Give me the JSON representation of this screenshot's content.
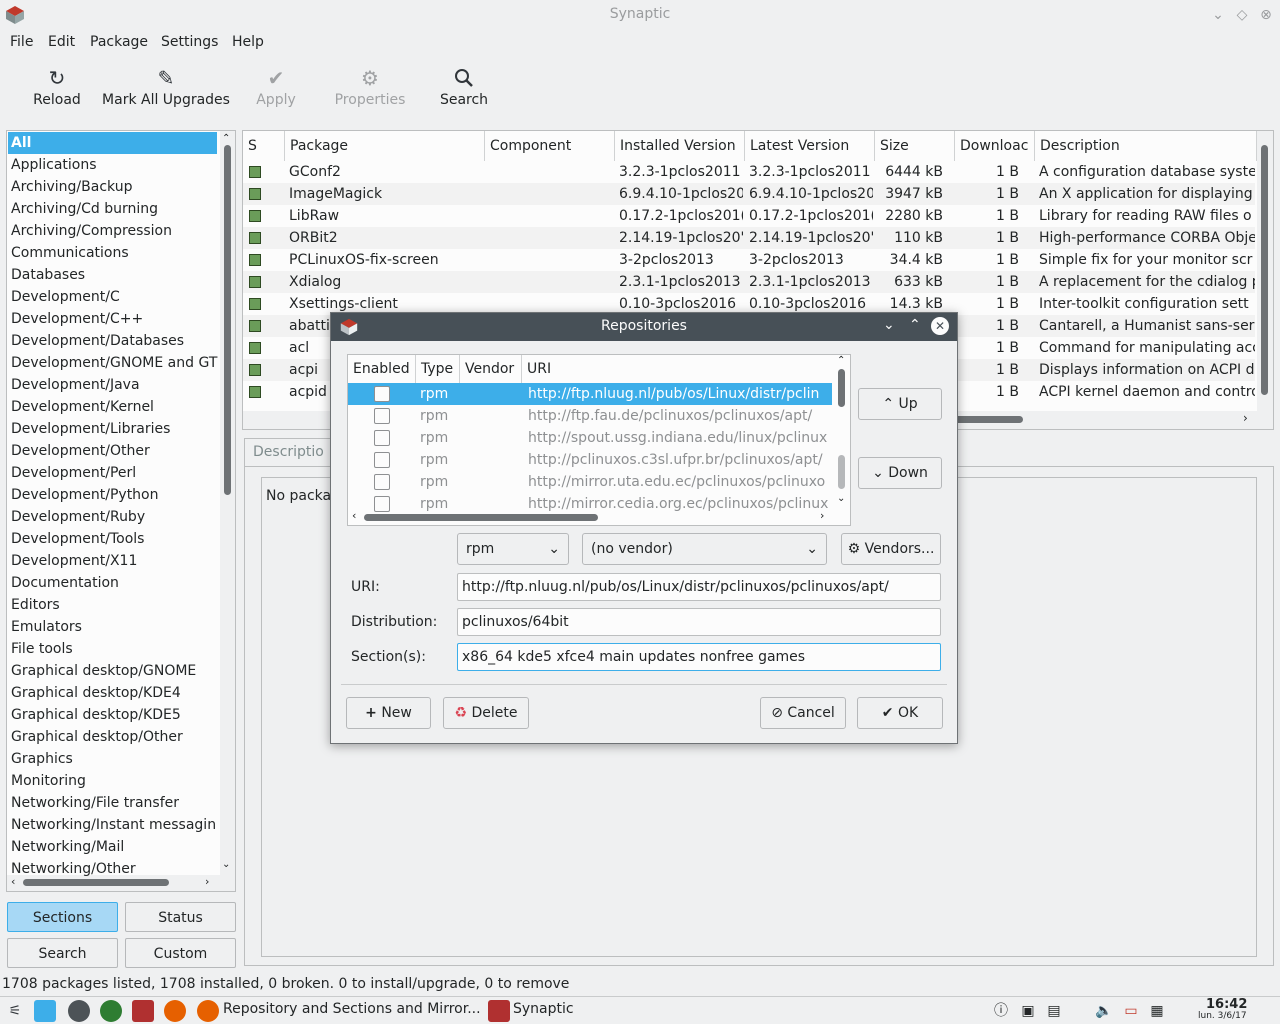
{
  "window": {
    "title": "Synaptic"
  },
  "menu": [
    "File",
    "Edit",
    "Package",
    "Settings",
    "Help"
  ],
  "toolbar": {
    "reload": "Reload",
    "mark_all": "Mark All Upgrades",
    "apply": "Apply",
    "properties": "Properties",
    "search": "Search"
  },
  "sidebar": {
    "items": [
      "All",
      "Applications",
      "Archiving/Backup",
      "Archiving/Cd burning",
      "Archiving/Compression",
      "Communications",
      "Databases",
      "Development/C",
      "Development/C++",
      "Development/Databases",
      "Development/GNOME and GT",
      "Development/Java",
      "Development/Kernel",
      "Development/Libraries",
      "Development/Other",
      "Development/Perl",
      "Development/Python",
      "Development/Ruby",
      "Development/Tools",
      "Development/X11",
      "Documentation",
      "Editors",
      "Emulators",
      "File tools",
      "Graphical desktop/GNOME",
      "Graphical desktop/KDE4",
      "Graphical desktop/KDE5",
      "Graphical desktop/Other",
      "Graphics",
      "Monitoring",
      "Networking/File transfer",
      "Networking/Instant messagin",
      "Networking/Mail",
      "Networking/Other"
    ],
    "buttons": {
      "sections": "Sections",
      "status": "Status",
      "search": "Search",
      "custom": "Custom"
    }
  },
  "packages": {
    "headers": [
      "S",
      "Package",
      "Component",
      "Installed Version",
      "Latest Version",
      "Size",
      "Downloac",
      "Description"
    ],
    "rows": [
      {
        "name": "GConf2",
        "inst": "3.2.3-1pclos2011",
        "latest": "3.2.3-1pclos2011",
        "size": "6444 kB",
        "dl": "1  B",
        "desc": "A configuration database syste"
      },
      {
        "name": "ImageMagick",
        "inst": "6.9.4.10-1pclos20",
        "latest": "6.9.4.10-1pclos20",
        "size": "3947 kB",
        "dl": "1  B",
        "desc": "An X application for displaying"
      },
      {
        "name": "LibRaw",
        "inst": "0.17.2-1pclos201(",
        "latest": "0.17.2-1pclos201(",
        "size": "2280 kB",
        "dl": "1  B",
        "desc": "Library for reading RAW files o"
      },
      {
        "name": "ORBit2",
        "inst": "2.14.19-1pclos20'",
        "latest": "2.14.19-1pclos20'",
        "size": "110 kB",
        "dl": "1  B",
        "desc": "High-performance CORBA Obje"
      },
      {
        "name": "PCLinuxOS-fix-screen",
        "inst": "3-2pclos2013",
        "latest": "3-2pclos2013",
        "size": "34.4 kB",
        "dl": "1  B",
        "desc": "Simple fix for your monitor scr"
      },
      {
        "name": "Xdialog",
        "inst": "2.3.1-1pclos2013",
        "latest": "2.3.1-1pclos2013",
        "size": "633 kB",
        "dl": "1  B",
        "desc": "A replacement for the cdialog p"
      },
      {
        "name": "Xsettings-client",
        "inst": "0.10-3pclos2016",
        "latest": "0.10-3pclos2016",
        "size": "14.3 kB",
        "dl": "1  B",
        "desc": "Inter-toolkit configuration sett"
      },
      {
        "name": "abatti",
        "inst": "",
        "latest": "",
        "size": "",
        "dl": "1  B",
        "desc": "Cantarell, a Humanist sans-seri"
      },
      {
        "name": "acl",
        "inst": "",
        "latest": "",
        "size": "",
        "dl": "1  B",
        "desc": "Command for manipulating acc"
      },
      {
        "name": "acpi",
        "inst": "",
        "latest": "",
        "size": "",
        "dl": "1  B",
        "desc": "Displays information on ACPI d"
      },
      {
        "name": "acpid",
        "inst": "",
        "latest": "",
        "size": "",
        "dl": "1  B",
        "desc": "ACPI kernel daemon and contro"
      }
    ]
  },
  "details": {
    "tab": "Descriptio",
    "text": "No packa"
  },
  "status": "1708 packages listed, 1708 installed, 0 broken. 0 to install/upgrade, 0 to remove",
  "taskbar": {
    "task1": "Repository and Sections and Mirror...",
    "task2": "Synaptic",
    "time": "16:42",
    "date": "lun. 3/6/17"
  },
  "dialog": {
    "title": "Repositories",
    "headers": [
      "Enabled",
      "Type",
      "Vendor",
      "URI"
    ],
    "rows": [
      {
        "type": "rpm",
        "uri": "http://ftp.nluug.nl/pub/os/Linux/distr/pclin"
      },
      {
        "type": "rpm",
        "uri": "http://ftp.fau.de/pclinuxos/pclinuxos/apt/"
      },
      {
        "type": "rpm",
        "uri": "http://spout.ussg.indiana.edu/linux/pclinux"
      },
      {
        "type": "rpm",
        "uri": "http://pclinuxos.c3sl.ufpr.br/pclinuxos/apt/"
      },
      {
        "type": "rpm",
        "uri": "http://mirror.uta.edu.ec/pclinuxos/pclinuxo"
      },
      {
        "type": "rpm",
        "uri": "http://mirror.cedia.org.ec/pclinuxos/pclinux"
      }
    ],
    "up": "Up",
    "down": "Down",
    "type_value": "rpm",
    "vendor_value": "(no vendor)",
    "vendors_btn": "Vendors...",
    "uri_label": "URI:",
    "uri_value": "http://ftp.nluug.nl/pub/os/Linux/distr/pclinuxos/pclinuxos/apt/",
    "dist_label": "Distribution:",
    "dist_value": "pclinuxos/64bit",
    "sect_label": "Section(s):",
    "sect_value": "x86_64 kde5 xfce4 main updates nonfree games",
    "new": "New",
    "delete": "Delete",
    "cancel": "Cancel",
    "ok": "OK"
  },
  "colors": {
    "accent": "#3daee9",
    "dialog_title": "#475057"
  }
}
